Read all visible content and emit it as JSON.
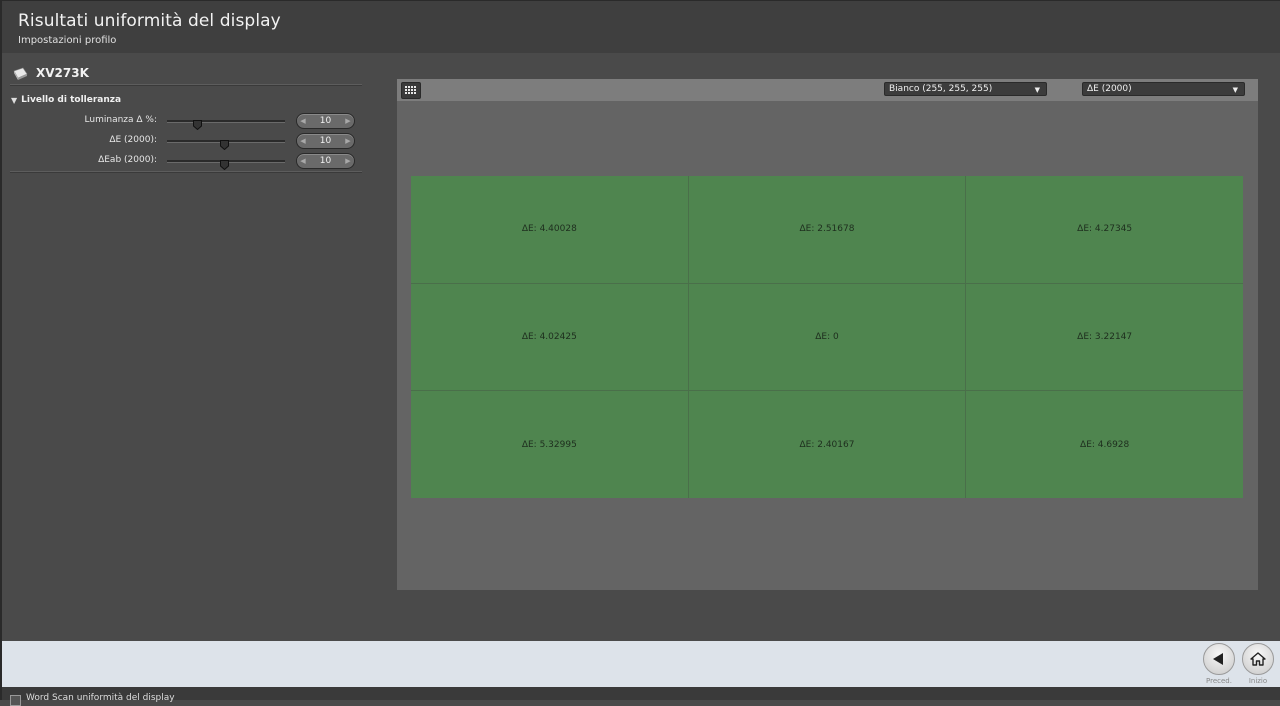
{
  "header": {
    "title": "Risultati uniformità del display",
    "subtitle": "Impostazioni profilo"
  },
  "device": {
    "name": "XV273K",
    "icon": "display-device-icon"
  },
  "tolerance": {
    "heading": "Livello di tolleranza",
    "rows": [
      {
        "label": "Luminanza Δ %:",
        "value": "10",
        "slider_fraction": 0.27
      },
      {
        "label": "ΔE (2000):",
        "value": "10",
        "slider_fraction": 0.5
      },
      {
        "label": "ΔEab (2000):",
        "value": "10",
        "slider_fraction": 0.5
      }
    ]
  },
  "toolbar": {
    "grid_icon": "grid-view-icon",
    "color_select": "Bianco (255, 255, 255)",
    "metric_select": "ΔE (2000)"
  },
  "grid": {
    "cells": [
      "ΔE: 4.40028",
      "ΔE: 2.51678",
      "ΔE: 4.27345",
      "ΔE: 4.02425",
      "ΔE: 0",
      "ΔE: 3.22147",
      "ΔE: 5.32995",
      "ΔE: 2.40167",
      "ΔE: 4.6928"
    ],
    "cell_color": "#4f854f"
  },
  "nav": {
    "back_label": "Preced.",
    "home_label": "Inizio"
  },
  "status": {
    "text": "Word Scan uniformità del display"
  }
}
